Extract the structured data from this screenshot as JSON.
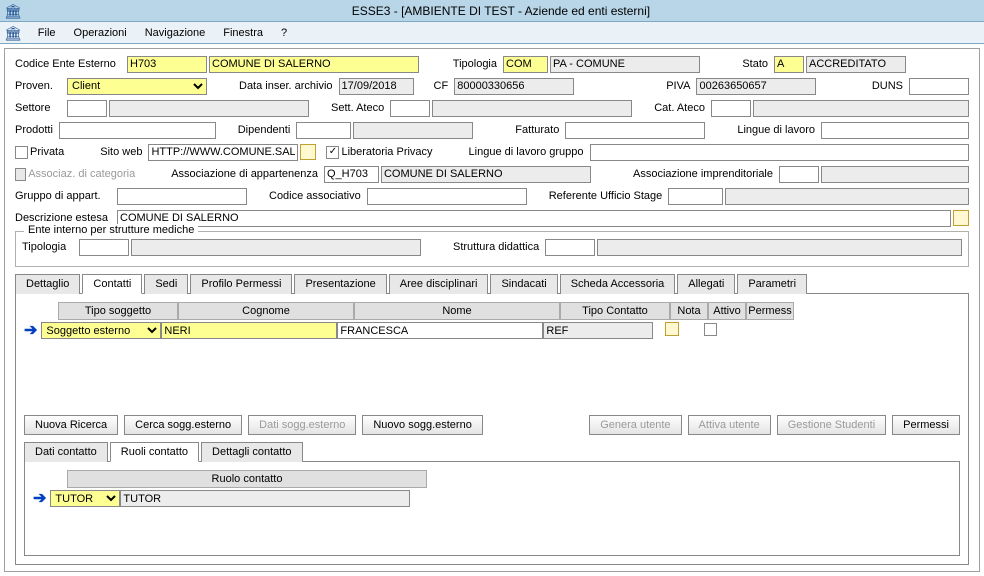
{
  "window": {
    "title": "ESSE3 - [AMBIENTE DI TEST - Aziende ed enti esterni]"
  },
  "menu": [
    "File",
    "Operazioni",
    "Navigazione",
    "Finestra",
    "?"
  ],
  "header": {
    "codice_lbl": "Codice Ente Esterno",
    "codice_val": "H703",
    "nome_val": "COMUNE DI SALERNO",
    "tipologia_lbl": "Tipologia",
    "tipologia_code": "COM",
    "tipologia_desc": "PA - COMUNE",
    "stato_lbl": "Stato",
    "stato_code": "A",
    "stato_desc": "ACCREDITATO",
    "proven_lbl": "Proven.",
    "proven_val": "Client",
    "data_inser_lbl": "Data inser. archivio",
    "data_inser_val": "17/09/2018",
    "cf_lbl": "CF",
    "cf_val": "80000330656",
    "piva_lbl": "PIVA",
    "piva_val": "00263650657",
    "duns_lbl": "DUNS",
    "settore_lbl": "Settore",
    "sett_ateco_lbl": "Sett. Ateco",
    "cat_ateco_lbl": "Cat. Ateco",
    "prodotti_lbl": "Prodotti",
    "dipendenti_lbl": "Dipendenti",
    "fatturato_lbl": "Fatturato",
    "lingue_lbl": "Lingue di lavoro",
    "privata_lbl": "Privata",
    "sito_lbl": "Sito web",
    "sito_val": "HTTP://WWW.COMUNE.SALE",
    "liberatoria_lbl": "Liberatoria Privacy",
    "lingue_gruppo_lbl": "Lingue di lavoro gruppo",
    "assoc_cat_lbl": "Associaz. di categoria",
    "assoc_app_lbl": "Associazione di appartenenza",
    "assoc_app_code": "Q_H703",
    "assoc_app_desc": "COMUNE DI SALERNO",
    "assoc_impr_lbl": "Associazione imprenditoriale",
    "gruppo_lbl": "Gruppo di appart.",
    "cod_assoc_lbl": "Codice associativo",
    "ref_stage_lbl": "Referente Ufficio Stage",
    "desc_estesa_lbl": "Descrizione estesa",
    "desc_estesa_val": "COMUNE DI SALERNO"
  },
  "ente_interno": {
    "legend": "Ente interno per strutture mediche",
    "tipologia_lbl": "Tipologia",
    "struttura_lbl": "Struttura didattica"
  },
  "tabs": [
    "Dettaglio",
    "Contatti",
    "Sedi",
    "Profilo Permessi",
    "Presentazione",
    "Aree disciplinari",
    "Sindacati",
    "Scheda Accessoria",
    "Allegati",
    "Parametri"
  ],
  "contatti_cols": [
    "Tipo soggetto",
    "Cognome",
    "Nome",
    "Tipo Contatto",
    "Nota",
    "Attivo",
    "Permess"
  ],
  "contatti_row": {
    "tipo_soggetto": "Soggetto esterno",
    "cognome": "NERI",
    "nome": "FRANCESCA",
    "tipo_contatto": "REF"
  },
  "buttons": {
    "nuova_ricerca": "Nuova Ricerca",
    "cerca_sogg": "Cerca sogg.esterno",
    "dati_sogg": "Dati sogg.esterno",
    "nuovo_sogg": "Nuovo sogg.esterno",
    "genera": "Genera utente",
    "attiva": "Attiva utente",
    "gestione": "Gestione Studenti",
    "permessi": "Permessi"
  },
  "subtabs": [
    "Dati contatto",
    "Ruoli contatto",
    "Dettagli contatto"
  ],
  "ruoli": {
    "col": "Ruolo contatto",
    "code": "TUTOR",
    "desc": "TUTOR"
  }
}
